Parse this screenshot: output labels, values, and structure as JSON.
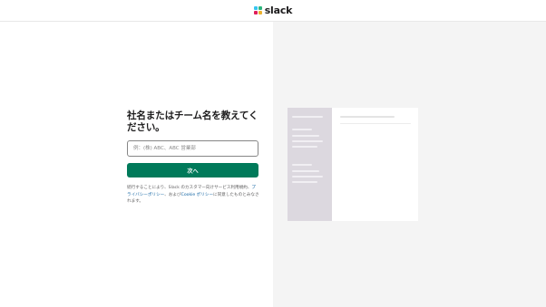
{
  "brand": {
    "name": "slack",
    "colors": [
      "#36c5f0",
      "#2eb67d",
      "#ecb22e",
      "#e01e5a"
    ]
  },
  "form": {
    "title": "社名またはチーム名を教えてください。",
    "input_value": "",
    "input_placeholder": "例：(株) ABC、ABC 営業部",
    "submit_label": "次へ",
    "accent_color": "#007a5a"
  },
  "terms": {
    "prefix": "続行することにより、Slack のカスタマー向けサービス利用規約、",
    "privacy_link": "プライバシーポリシー",
    "middle": "、および",
    "cookie_link": "Cookie ポリシー",
    "suffix": "に同意したものとみなされます。"
  }
}
